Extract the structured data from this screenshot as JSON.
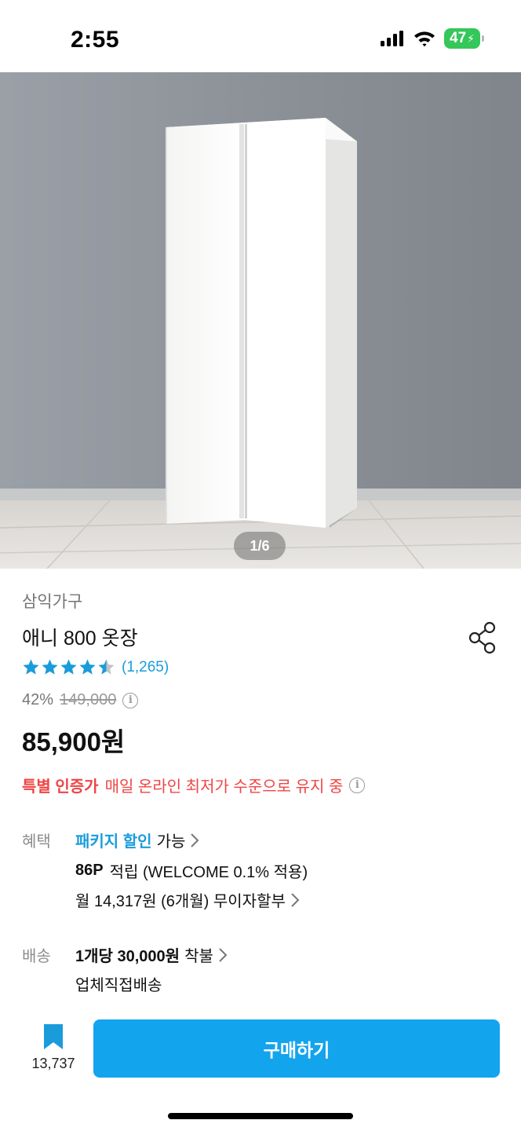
{
  "status_bar": {
    "time": "2:55",
    "battery": "47"
  },
  "gallery": {
    "page_indicator": "1/6"
  },
  "product": {
    "brand": "삼익가구",
    "name": "애니 800 옷장",
    "rating": 4.5,
    "review_count": "(1,265)",
    "discount_percent": "42%",
    "original_price": "149,000",
    "price": "85,900원"
  },
  "promo": {
    "label": "특별 인증가",
    "text": "매일 온라인 최저가 수준으로 유지 중"
  },
  "benefits": {
    "label": "혜택",
    "package_discount": "패키지 할인",
    "package_suffix": "가능",
    "points": "86P",
    "points_suffix": "적립 (WELCOME 0.1% 적용)",
    "installment": "월 14,317원 (6개월) 무이자할부"
  },
  "shipping": {
    "label": "배송",
    "fee": "1개당 30,000원",
    "fee_suffix": "착불",
    "method": "업체직접배송"
  },
  "bottom_bar": {
    "wishlist_count": "13,737",
    "buy_label": "구매하기"
  },
  "colors": {
    "accent": "#13a4ee",
    "link": "#1a9cdb",
    "promo_red": "#ef4545",
    "star": "#1a9cdb"
  },
  "icons": [
    "signal-icon",
    "wifi-icon",
    "battery-icon",
    "share-icon",
    "star-icon",
    "info-icon",
    "chevron-right-icon",
    "bookmark-icon"
  ]
}
